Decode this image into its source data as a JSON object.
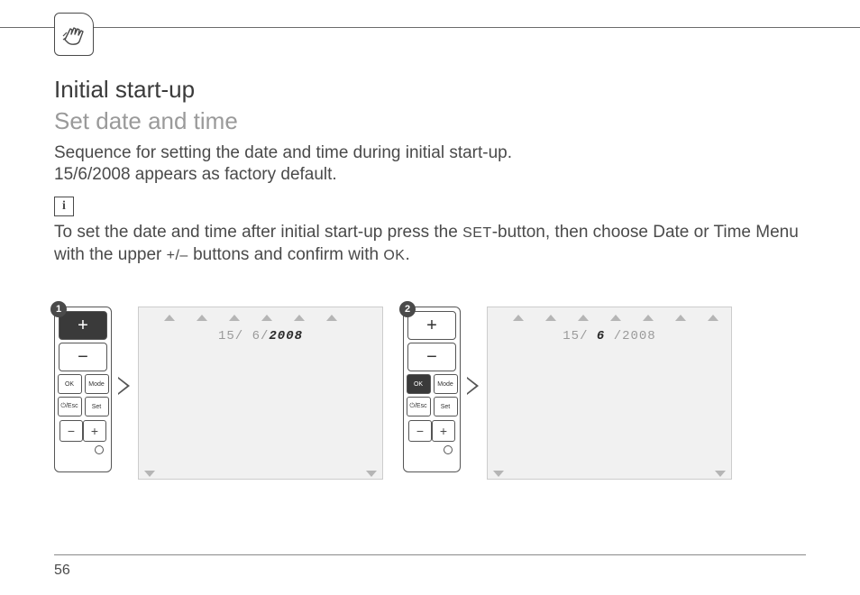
{
  "page_number": 56,
  "headings": {
    "title": "Initial start-up",
    "subtitle": "Set date and time"
  },
  "paragraphs": {
    "p1a": "Sequence for setting the date and time during initial start-up.",
    "p1b": "15/6/2008 appears as factory default.",
    "p2_pre": "To set the date and time after initial start-up press the ",
    "p2_set": "SET",
    "p2_mid": "-button, then choose Date or Time Menu with the upper ",
    "p2_plusminus": "+/–",
    "p2_mid2": " buttons and confirm with ",
    "p2_ok": "OK",
    "p2_end": "."
  },
  "info_icon_glyph": "i",
  "keypad_labels": {
    "plus_top": "+",
    "minus_top": "−",
    "ok": "OK",
    "mode": "Mode",
    "esc": "⏻/Esc",
    "set": "Set",
    "minus_bottom": "−",
    "plus_bottom": "+"
  },
  "steps": [
    {
      "badge": "1",
      "highlight": "plus_top",
      "screen_prefix": "15/ 6/",
      "screen_highlight": "2008",
      "screen_suffix": ""
    },
    {
      "badge": "2",
      "highlight": "ok",
      "screen_prefix": "15/ ",
      "screen_highlight": "6",
      "screen_suffix": " /2008"
    }
  ]
}
